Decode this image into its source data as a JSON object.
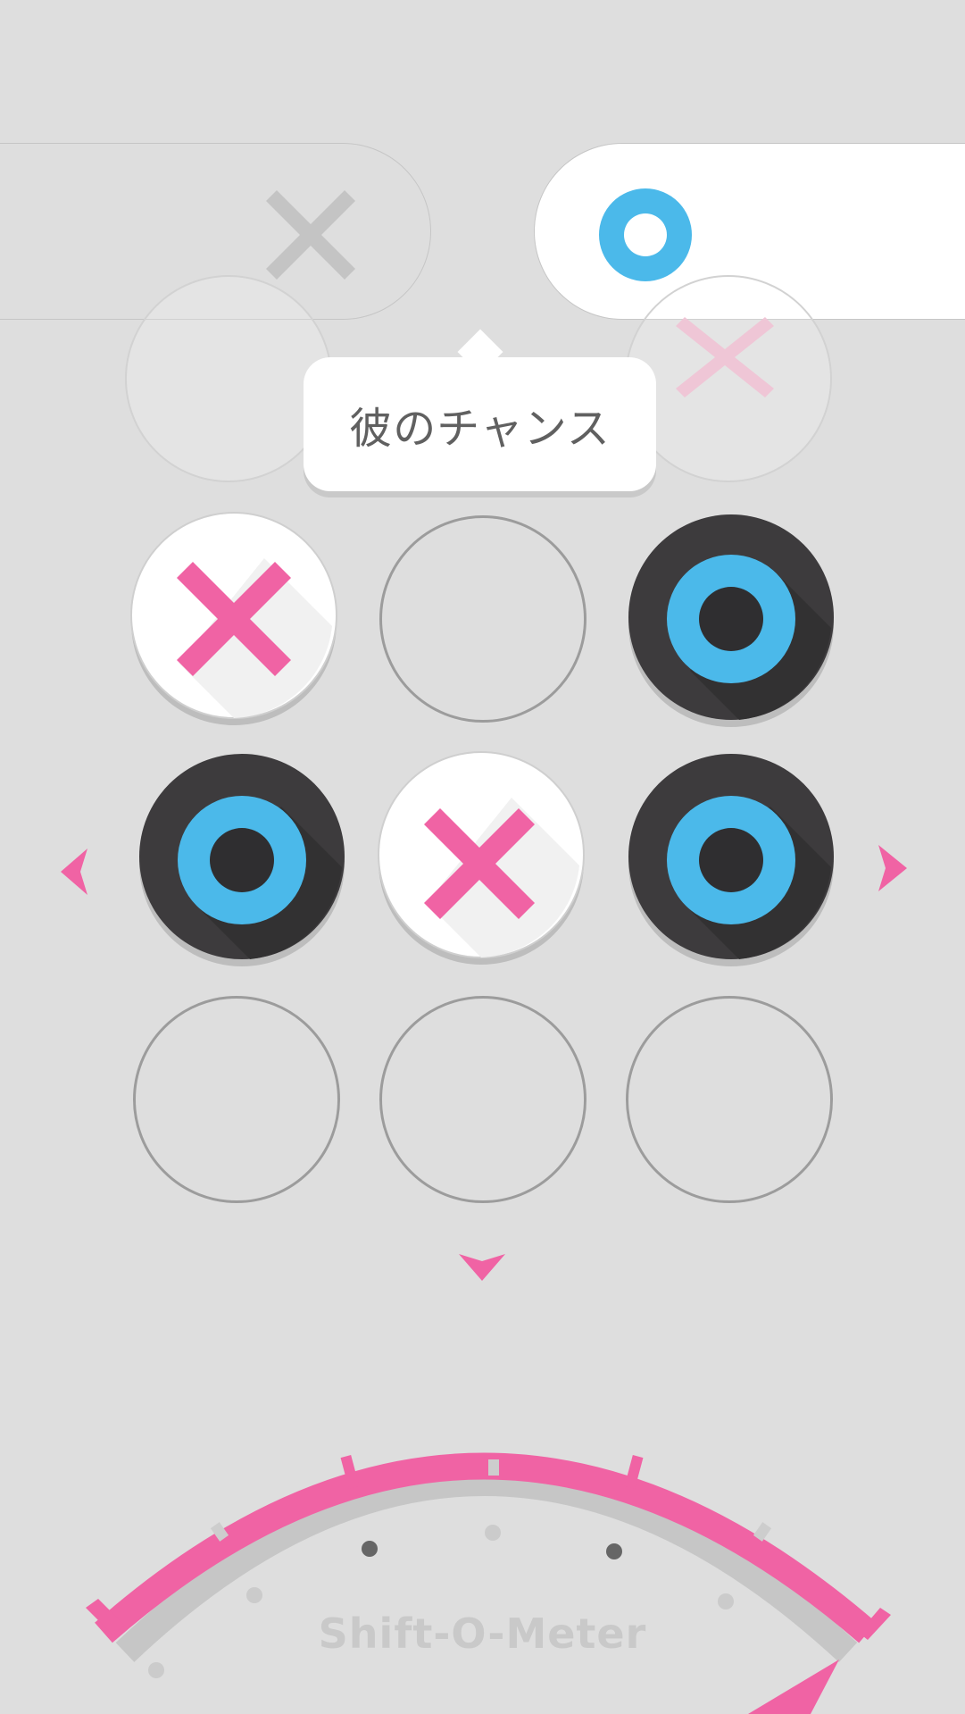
{
  "players": {
    "x": {
      "icon": "x-mark-icon",
      "active": false
    },
    "o": {
      "icon": "o-ring-icon",
      "active": true
    }
  },
  "turn_tooltip": "彼のチャンス",
  "board": [
    [
      "X",
      "",
      "O"
    ],
    [
      "O",
      "X",
      "O"
    ],
    [
      "",
      "",
      ""
    ]
  ],
  "navigation": {
    "left": "arrow-left-icon",
    "right": "arrow-right-icon",
    "down": "arrow-down-icon"
  },
  "meter": {
    "label": "Shift-O-Meter"
  },
  "colors": {
    "background": "#dedede",
    "x_mark": "#f063a4",
    "o_ring": "#4bb9ea",
    "o_piece": "#3d3b3d",
    "x_piece": "#ffffff",
    "accent": "#f063a4",
    "empty_cell_border": "#9c9c9c"
  }
}
